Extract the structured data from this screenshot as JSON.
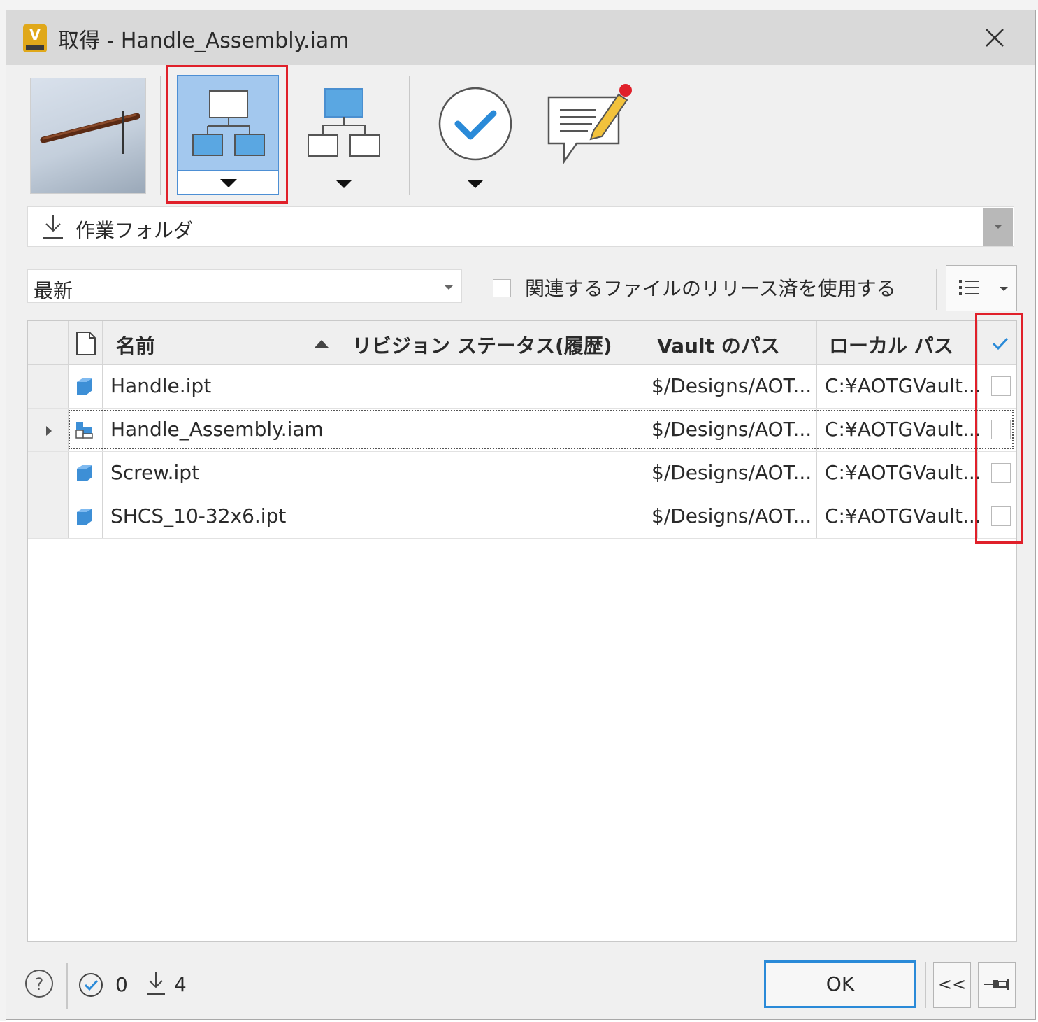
{
  "dialog": {
    "title": "取得 - Handle_Assembly.iam",
    "app_icon_letter": "V",
    "close_icon": "close-icon"
  },
  "toolbar": {
    "thumbnail_icon": "model-thumbnail",
    "buttons": [
      {
        "icon": "include-children-icon",
        "active": true,
        "has_dropdown": true
      },
      {
        "icon": "include-parents-icon",
        "active": false,
        "has_dropdown": true
      },
      {
        "icon": "checkmark-circle-icon",
        "active": false,
        "has_dropdown": true
      },
      {
        "icon": "comment-edit-icon",
        "active": false,
        "has_dropdown": false
      }
    ]
  },
  "folder": {
    "icon": "download-arrow-icon",
    "label": "作業フォルダ"
  },
  "version": {
    "selected": "最新",
    "released_checkbox_label": "関連するファイルのリリース済を使用する",
    "released_checked": false
  },
  "grid": {
    "columns": [
      "名前",
      "リビジョン",
      "ステータス(履歴)",
      "Vault のパス",
      "ローカル パス"
    ],
    "sort_column": "名前",
    "sort_direction": "ascending",
    "rows": [
      {
        "icon": "part-icon",
        "name": "Handle.ipt",
        "revision": "",
        "status": "",
        "vault_path": "$/Designs/AOT...",
        "local_path": "C:¥AOTGVault...",
        "checked": false,
        "expandable": false
      },
      {
        "icon": "assembly-icon",
        "name": "Handle_Assembly.iam",
        "revision": "",
        "status": "",
        "vault_path": "$/Designs/AOT...",
        "local_path": "C:¥AOTGVault...",
        "checked": false,
        "expandable": true
      },
      {
        "icon": "part-icon",
        "name": "Screw.ipt",
        "revision": "",
        "status": "",
        "vault_path": "$/Designs/AOT...",
        "local_path": "C:¥AOTGVault...",
        "checked": false,
        "expandable": false
      },
      {
        "icon": "part-icon",
        "name": "SHCS_10-32x6.ipt",
        "revision": "",
        "status": "",
        "vault_path": "$/Designs/AOT...",
        "local_path": "C:¥AOTGVault...",
        "checked": false,
        "expandable": false
      }
    ]
  },
  "status_bar": {
    "checked_count": "0",
    "download_count": "4"
  },
  "buttons": {
    "ok": "OK",
    "collapse": "<<"
  },
  "colors": {
    "accent": "#2a8ad8",
    "highlight_box": "#e0202a",
    "active_button": "#a3c8ee",
    "part_blue": "#3d8fd6"
  }
}
